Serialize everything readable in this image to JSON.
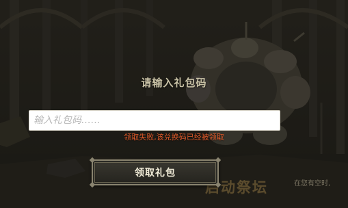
{
  "dialog": {
    "title": "请输入礼包码",
    "input_placeholder": "输入礼包码……",
    "input_value": "",
    "error_message": "领取失败,该兑换码已经被领取",
    "claim_button": "领取礼包"
  },
  "background": {
    "altar_title": "启动祭坛",
    "altar_subtitle": "在您有空时,"
  },
  "colors": {
    "error": "#e05a2a",
    "title": "#c9c2a6",
    "button_text": "#f1ecd8"
  }
}
